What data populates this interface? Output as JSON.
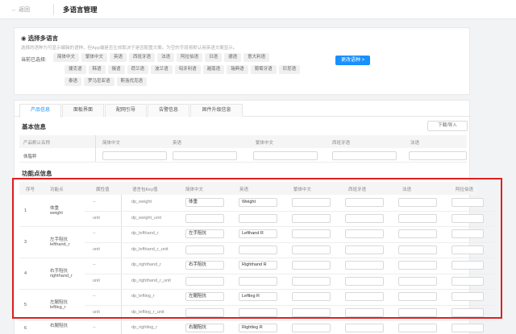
{
  "header": {
    "back_label": "返回",
    "title": "多语言管理"
  },
  "lang_panel": {
    "title": "选择多语言",
    "description": "选择的语种为可显示编辑的语种，但App端是否生效取决于是否配置文案。为空的字段将默认用英语文案显示。",
    "current_label": "当前已选择:",
    "languages": [
      [
        "简体中文",
        "繁体中文",
        "英语",
        "西班牙语",
        "法语",
        "阿拉伯语",
        "日语",
        "德语",
        "意大利语"
      ],
      [
        "捷克语",
        "韩语",
        "俄语",
        "荷兰语",
        "波兰语",
        "匈牙利语",
        "越南语",
        "瑞典语",
        "葡萄牙语",
        "印尼语"
      ],
      [
        "泰语",
        "罗马尼亚语",
        "斯洛伐克语"
      ]
    ],
    "change_button": "更改语种 >"
  },
  "tabs": [
    {
      "label": "产品信息",
      "active": true
    },
    {
      "label": "面板界面",
      "active": false
    },
    {
      "label": "配网引导",
      "active": false
    },
    {
      "label": "告警信息",
      "active": false
    },
    {
      "label": "固件升级信息",
      "active": false
    }
  ],
  "basic": {
    "title": "基本信息",
    "download_button": "下载/导入",
    "headers": [
      "产品默认名称",
      "简体中文",
      "英语",
      "繁体中文",
      "西班牙语",
      "法语"
    ],
    "row_name": "体脂秤"
  },
  "functions": {
    "title": "功能点信息",
    "headers": [
      "序号",
      "功能点",
      "属性值",
      "语言包Key值",
      "简体中文",
      "英语",
      "繁体中文",
      "西班牙语",
      "法语",
      "阿拉伯语"
    ],
    "groups": [
      {
        "no": "1",
        "name": "体重",
        "code": "weight",
        "rows": [
          {
            "attr": "--",
            "key": "dp_weight",
            "zh": "体重",
            "en": "Weight"
          },
          {
            "attr": "unit",
            "key": "dp_weight_unit",
            "zh": "",
            "en": ""
          }
        ]
      },
      {
        "no": "3",
        "name": "左手阻抗",
        "code": "lefthand_r",
        "rows": [
          {
            "attr": "--",
            "key": "dp_lefthand_r",
            "zh": "左手阻抗",
            "en": "Lefthand R"
          },
          {
            "attr": "unit",
            "key": "dp_lefthand_r_unit",
            "zh": "",
            "en": ""
          }
        ]
      },
      {
        "no": "4",
        "name": "右手阻抗",
        "code": "righthand_r",
        "rows": [
          {
            "attr": "--",
            "key": "dp_righthand_r",
            "zh": "右手阻抗",
            "en": "Righthand R"
          },
          {
            "attr": "unit",
            "key": "dp_righthand_r_unit",
            "zh": "",
            "en": ""
          }
        ]
      },
      {
        "no": "5",
        "name": "左腿阻抗",
        "code": "leftleg_r",
        "rows": [
          {
            "attr": "--",
            "key": "dp_leftleg_r",
            "zh": "左腿阻抗",
            "en": "Leftleg R"
          },
          {
            "attr": "unit",
            "key": "dp_leftleg_r_unit",
            "zh": "",
            "en": ""
          }
        ]
      },
      {
        "no": "6",
        "name": "右腿阻抗",
        "code": "",
        "rows": [
          {
            "attr": "--",
            "key": "dp_rightleg_r",
            "zh": "右腿阻抗",
            "en": "Rightleg R"
          }
        ]
      }
    ]
  },
  "colors": {
    "accent": "#1890ff",
    "highlight": "#e02020"
  }
}
